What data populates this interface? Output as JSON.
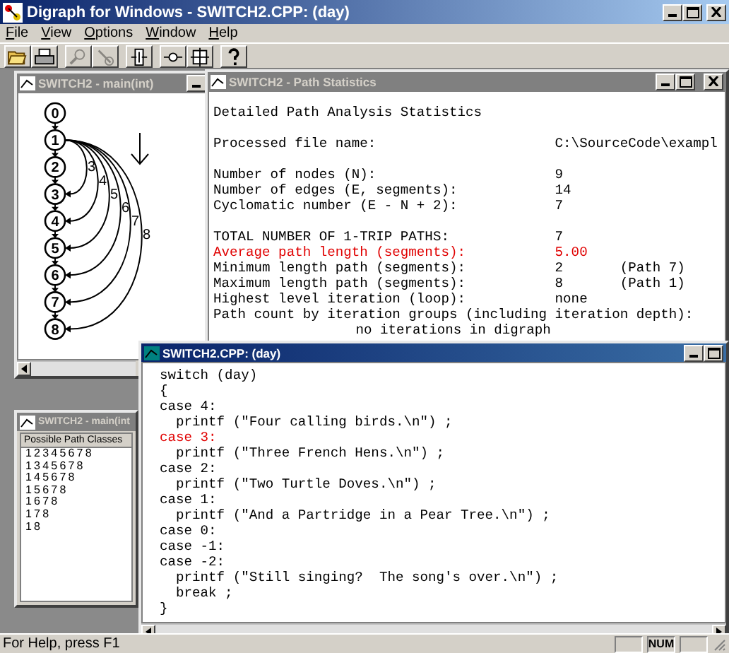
{
  "window": {
    "title": "Digraph for Windows - SWITCH2.CPP: (day)"
  },
  "menu": [
    "File",
    "View",
    "Options",
    "Window",
    "Help"
  ],
  "toolbar": [
    {
      "disabled": false
    },
    {
      "disabled": false
    },
    {
      "disabled": true
    },
    {
      "disabled": true
    },
    {
      "disabled": false
    },
    {
      "disabled": false
    },
    {
      "disabled": false
    },
    {
      "disabled": false
    }
  ],
  "documents": [
    {
      "kind": "graph",
      "title": "SWITCH2 - main(int)",
      "active": false,
      "nodes": [
        "0",
        "1",
        "2",
        "3",
        "4",
        "5",
        "6",
        "7",
        "8"
      ],
      "arcs": [
        {
          "label": "3"
        },
        {
          "label": "4"
        },
        {
          "label": "5"
        },
        {
          "label": "6"
        },
        {
          "label": "7"
        },
        {
          "label": "8"
        }
      ]
    },
    {
      "kind": "stats",
      "title": "SWITCH2 - Path Statistics",
      "active": false,
      "sections": [
        [
          {
            "kind": "text",
            "text": "Detailed Path Analysis Statistics",
            "highlighted": false
          }
        ],
        [
          {
            "kind": "row",
            "label": "Processed file name:",
            "value": "C:\\SourceCode\\exampl",
            "highlighted": false
          }
        ],
        [
          {
            "kind": "row",
            "label": "Number of nodes (N):",
            "value": "9",
            "highlighted": false
          },
          {
            "kind": "row",
            "label": "Number of edges (E, segments):",
            "value": "14",
            "highlighted": false
          },
          {
            "kind": "row",
            "label": "Cyclomatic number (E - N + 2):",
            "value": "7",
            "highlighted": false
          }
        ],
        [
          {
            "kind": "row",
            "label": "TOTAL NUMBER OF 1-TRIP PATHS:",
            "value": "7",
            "highlighted": false
          },
          {
            "kind": "row",
            "label": "Average path length (segments):",
            "value": "5.00",
            "highlighted": true
          },
          {
            "kind": "row",
            "label": "Minimum length path (segments):",
            "value": "2",
            "note": "(Path 7)",
            "highlighted": false
          },
          {
            "kind": "row",
            "label": "Maximum length path (segments):",
            "value": "8",
            "note": "(Path 1)",
            "highlighted": false
          },
          {
            "kind": "row",
            "label": "Highest level iteration (loop):",
            "value": "none",
            "highlighted": false
          },
          {
            "kind": "text",
            "text": "Path count by iteration groups (including iteration depth):",
            "highlighted": false
          },
          {
            "kind": "indented",
            "text": "no iterations in digraph",
            "highlighted": false
          }
        ]
      ]
    },
    {
      "kind": "paths",
      "title": "SWITCH2 - main(int",
      "active": false,
      "header": "Possible Path Classes",
      "items": [
        "12345678",
        "1345678",
        "145678",
        "15678",
        "1678",
        "178",
        "18"
      ]
    },
    {
      "kind": "code",
      "title": "SWITCH2.CPP: (day)",
      "active": true,
      "lines": [
        {
          "text": "switch (day)",
          "highlighted": false
        },
        {
          "text": "{",
          "highlighted": false
        },
        {
          "text": "case 4:",
          "highlighted": false
        },
        {
          "text": "  printf (\"Four calling birds.\\n\") ;",
          "highlighted": false
        },
        {
          "text": "case 3:",
          "highlighted": true
        },
        {
          "text": "  printf (\"Three French Hens.\\n\") ;",
          "highlighted": false
        },
        {
          "text": "case 2:",
          "highlighted": false
        },
        {
          "text": "  printf (\"Two Turtle Doves.\\n\") ;",
          "highlighted": false
        },
        {
          "text": "case 1:",
          "highlighted": false
        },
        {
          "text": "  printf (\"And a Partridge in a Pear Tree.\\n\") ;",
          "highlighted": false
        },
        {
          "text": "case 0:",
          "highlighted": false
        },
        {
          "text": "case -1:",
          "highlighted": false
        },
        {
          "text": "case -2:",
          "highlighted": false
        },
        {
          "text": "  printf (\"Still singing?  The song's over.\\n\") ;",
          "highlighted": false
        },
        {
          "text": "  break ;",
          "highlighted": false
        },
        {
          "text": "}",
          "highlighted": false
        }
      ]
    }
  ],
  "status_bar": {
    "text": "For Help, press F1",
    "indicators": [
      "NUM"
    ]
  }
}
